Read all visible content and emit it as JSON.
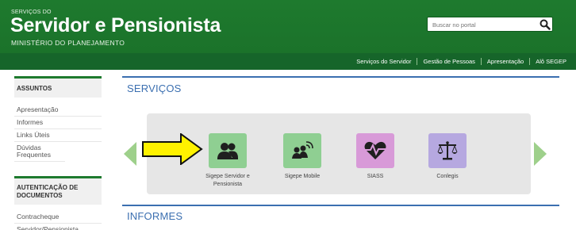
{
  "header": {
    "pretitle": "SERVIÇOS DO",
    "title": "Servidor e Pensionista",
    "subtitle": "MINISTÉRIO DO PLANEJAMENTO",
    "search_placeholder": "Buscar no portal",
    "nav": [
      "Serviços do Servidor",
      "Gestão de Pessoas",
      "Apresentação",
      "Alô SEGEP"
    ],
    "colors": {
      "brand": "#1e7a2e",
      "nav_bar": "#16652a"
    }
  },
  "sidebar": {
    "assuntos_title": "ASSUNTOS",
    "assuntos": [
      "Apresentação",
      "Informes",
      "Links Úteis",
      "Dúvidas Frequentes"
    ],
    "auth_title": "AUTENTICAÇÃO DE DOCUMENTOS",
    "auth": [
      "Contracheque",
      "Servidor/Pensionista"
    ]
  },
  "main": {
    "servicos_title": "SERVIÇOS",
    "informes_title": "INFORMES",
    "services": [
      {
        "label": "Sigepe Servidor e Pensionista",
        "icon": "users-icon",
        "color": "#8fcf92"
      },
      {
        "label": "Sigepe Mobile",
        "icon": "mobile-users-icon",
        "color": "#8fcf92"
      },
      {
        "label": "SIASS",
        "icon": "heart-pulse-icon",
        "color": "#d89ad8"
      },
      {
        "label": "Conlegis",
        "icon": "scales-icon",
        "color": "#b6a8e0"
      }
    ],
    "colors": {
      "section_accent": "#3b6fb0",
      "carousel_arrow": "#9ed08b",
      "pointer_arrow": "#fff200"
    }
  }
}
